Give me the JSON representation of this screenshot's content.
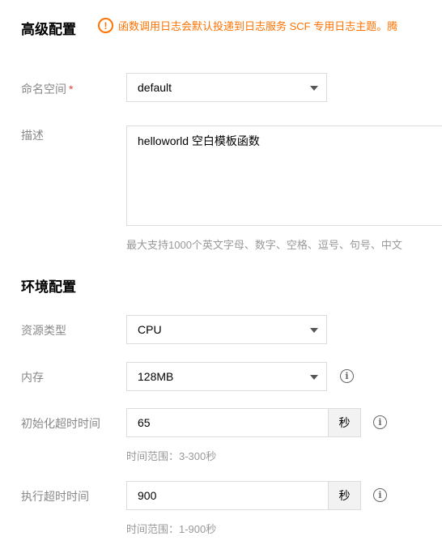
{
  "advanced": {
    "title": "高级配置",
    "notice_icon": "warning-circle-icon",
    "notice": "函数调用日志会默认投递到日志服务 SCF 专用日志主题。腾"
  },
  "namespace": {
    "label": "命名空间",
    "required_mark": "*",
    "value": "default"
  },
  "description": {
    "label": "描述",
    "value": "helloworld 空白模板函数",
    "hint": "最大支持1000个英文字母、数字、空格、逗号、句号、中文"
  },
  "environment": {
    "title": "环境配置"
  },
  "resource_type": {
    "label": "资源类型",
    "value": "CPU"
  },
  "memory": {
    "label": "内存",
    "value": "128MB"
  },
  "init_timeout": {
    "label": "初始化超时时间",
    "value": "65",
    "unit": "秒",
    "hint": "时间范围：3-300秒"
  },
  "exec_timeout": {
    "label": "执行超时时间",
    "value": "900",
    "unit": "秒",
    "hint": "时间范围：1-900秒"
  },
  "colors": {
    "warning": "#ff7200",
    "required": "#e54545",
    "label": "#888888"
  }
}
